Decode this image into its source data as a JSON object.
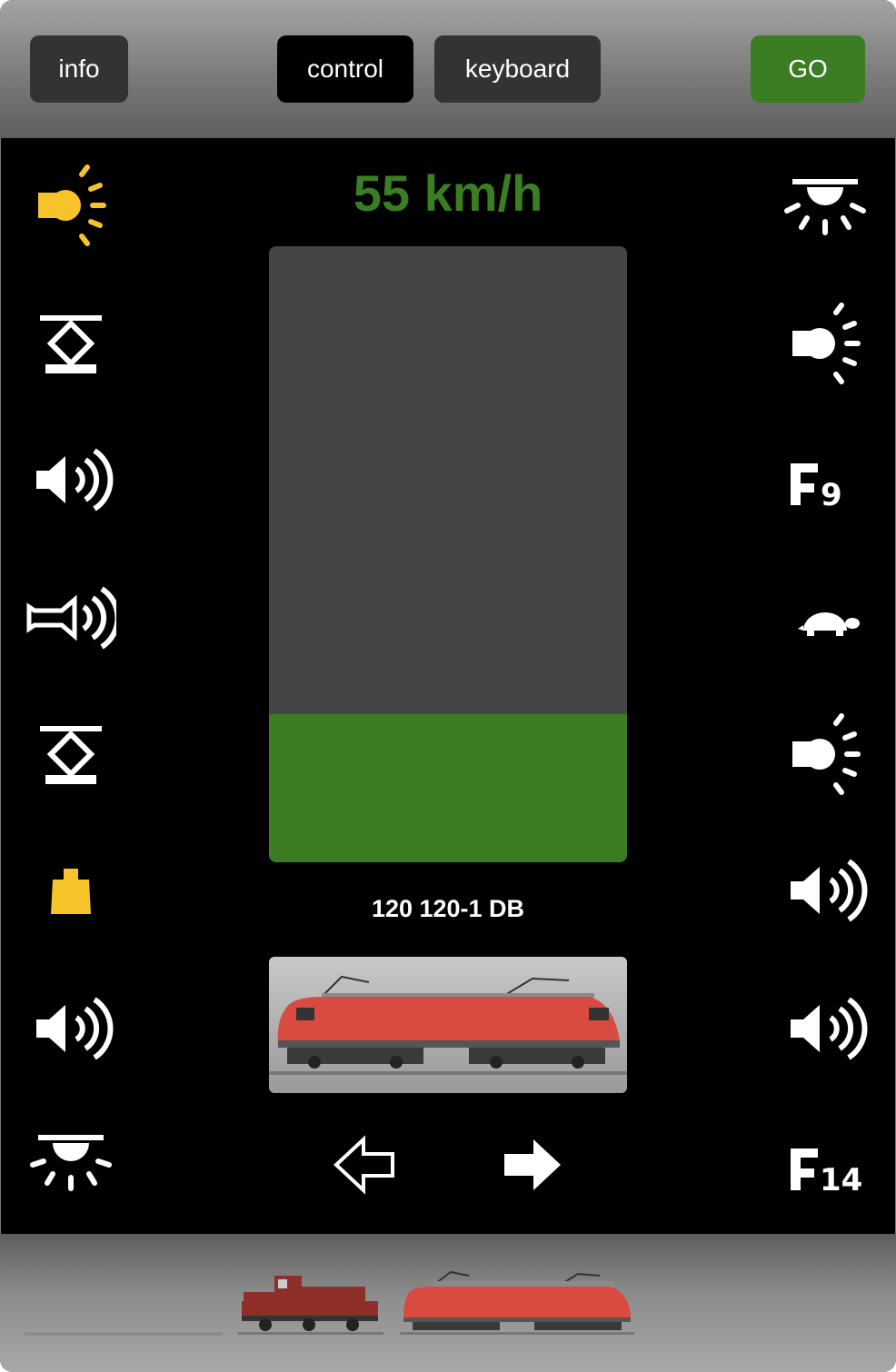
{
  "header": {
    "info_label": "info",
    "control_label": "control",
    "keyboard_label": "keyboard",
    "go_label": "GO",
    "go_color": "#3a7d23"
  },
  "speed": {
    "display": "55 km/h",
    "value_kmh": 55,
    "slider_fraction": 0.24
  },
  "loco": {
    "name": "120 120-1 DB",
    "direction_options": [
      "reverse",
      "forward"
    ],
    "active_direction": "forward"
  },
  "functions_left": [
    {
      "icon": "headlight-icon",
      "active": true
    },
    {
      "icon": "pantograph-icon",
      "active": false
    },
    {
      "icon": "sound-icon",
      "active": false
    },
    {
      "icon": "horn-icon",
      "active": false
    },
    {
      "icon": "pantograph-icon",
      "active": false
    },
    {
      "icon": "weight-icon",
      "active": true
    },
    {
      "icon": "sound-icon",
      "active": false
    },
    {
      "icon": "cab-light-icon",
      "active": false
    }
  ],
  "functions_right": [
    {
      "icon": "cab-light-icon",
      "active": false
    },
    {
      "icon": "headlight-icon",
      "active": false
    },
    {
      "icon": "function-label",
      "text": "9",
      "active": false
    },
    {
      "icon": "turtle-icon",
      "active": false
    },
    {
      "icon": "headlight-icon",
      "active": false
    },
    {
      "icon": "sound-icon",
      "active": false
    },
    {
      "icon": "sound-icon",
      "active": false
    },
    {
      "icon": "function-label",
      "text": "14",
      "active": false
    }
  ],
  "colors": {
    "active_icon": "#f6c32a",
    "inactive_icon": "#ffffff",
    "accent_green": "#3a7d23"
  },
  "loco_list": [
    {
      "type": "empty-slot"
    },
    {
      "type": "diesel-loco",
      "color": "#8e2f2a"
    },
    {
      "type": "electric-loco",
      "color": "#d94a40",
      "selected": true
    }
  ]
}
